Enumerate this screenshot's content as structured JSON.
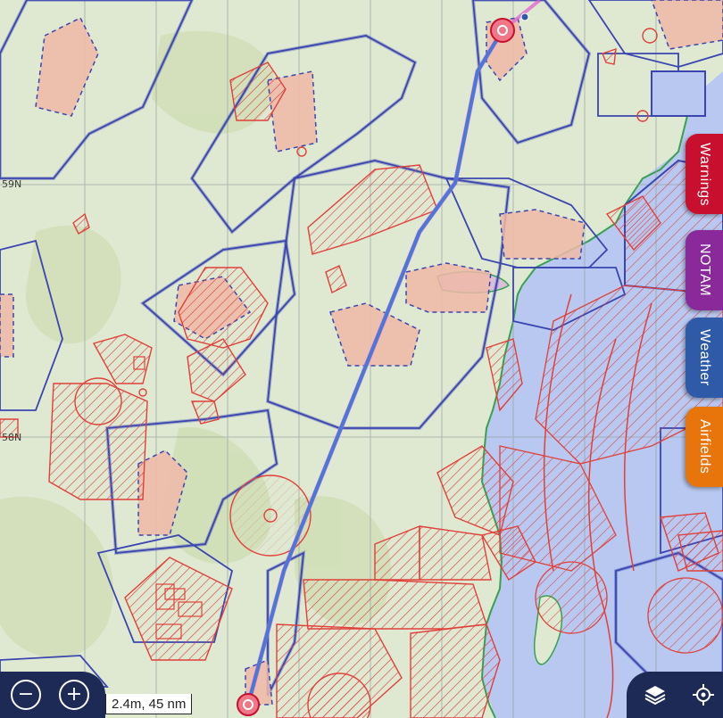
{
  "map": {
    "latitude_labels": [
      "59N",
      "58N"
    ],
    "colors": {
      "land": "#dfe9d2",
      "sea": "#b8c8f0",
      "zone_outline": "#3a45b0",
      "restricted": "#e0403a",
      "restricted_fill": "#f0b8a8",
      "route": "#4a78d8",
      "route_magenta": "#e060d0"
    }
  },
  "side_tabs": [
    {
      "label": "Warnings",
      "color": "#c8102e"
    },
    {
      "label": "NOTAM",
      "color": "#8a2a9a"
    },
    {
      "label": "Weather",
      "color": "#2f5aa8"
    },
    {
      "label": "Airfields",
      "color": "#e8740c"
    }
  ],
  "controls": {
    "zoom_out_icon": "minus-circle-icon",
    "zoom_in_icon": "plus-circle-icon",
    "zoom_out_symbol": "−",
    "zoom_in_symbol": "+",
    "scale_text": "2.4m, 45 nm",
    "layers_icon": "layers-icon",
    "locate_icon": "crosshair-icon"
  }
}
